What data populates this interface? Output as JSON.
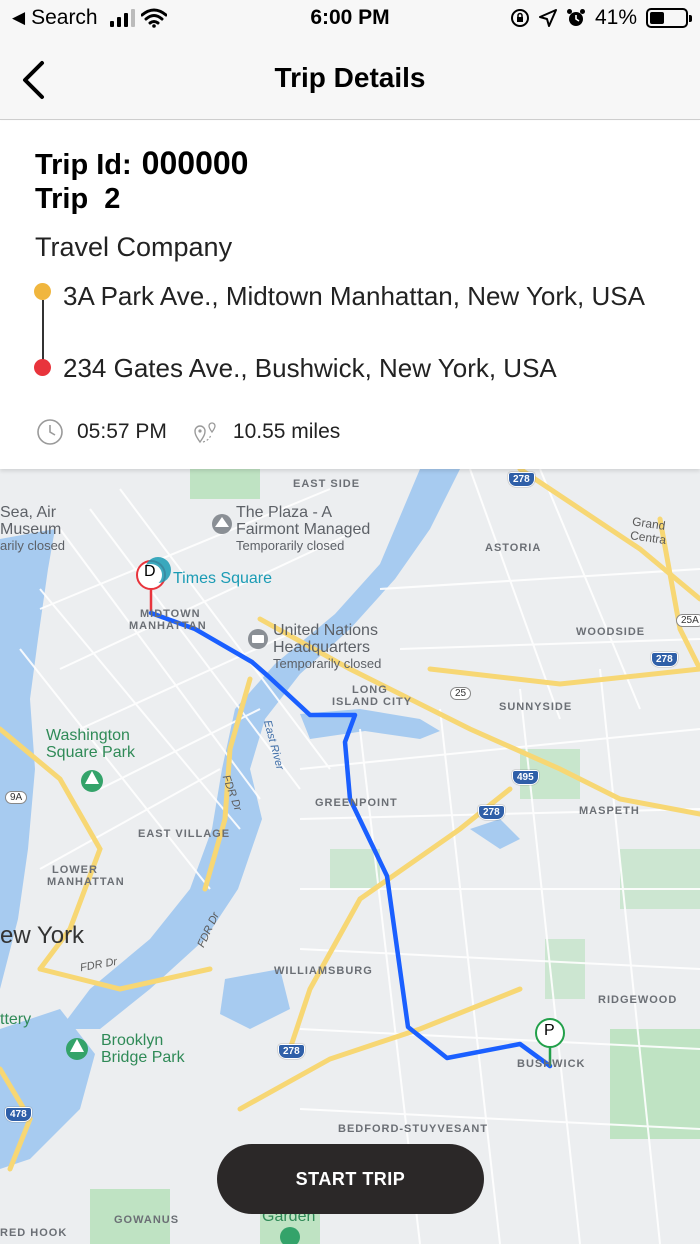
{
  "status_bar": {
    "back_label": "Search",
    "time": "6:00 PM",
    "battery": "41%",
    "battery_level": 0.41
  },
  "nav": {
    "title": "Trip Details"
  },
  "trip": {
    "id_label": "Trip Id:",
    "id_value": "000000",
    "name": "Trip  2",
    "company": "Travel Company",
    "origin": "3A Park Ave., Midtown Manhattan, New York, USA",
    "destination": "234 Gates Ave., Bushwick, New York, USA",
    "time": "05:57 PM",
    "distance": "10.55 miles"
  },
  "map": {
    "destination_marker": "D",
    "pickup_marker": "P",
    "route_color": "#1a5fff",
    "labels": {
      "east_side": "EAST SIDE",
      "astoria": "ASTORIA",
      "midtown": "MIDTOWN",
      "manhattan": "MANHATTAN",
      "woodside": "WOODSIDE",
      "long": "LONG",
      "island_city": "ISLAND CITY",
      "sunnyside": "SUNNYSIDE",
      "greenpoint": "GREENPOINT",
      "maspeth": "MASPETH",
      "east_village": "EAST VILLAGE",
      "lower": "LOWER",
      "lower_manhattan": "MANHATTAN",
      "williamsburg": "WILLIAMSBURG",
      "ridgewood": "RIDGEWOOD",
      "bushwick": "BUSHWICK",
      "bedford": "BEDFORD-STUYVESANT",
      "gowanus": "GOWANUS",
      "red_hook": "RED HOOK",
      "new_york": "ew York",
      "grand_central": "Grand Centra",
      "fdr_dr_1": "FDR Dr",
      "fdr_dr_2": "FDR Dr",
      "fdr_dr_3": "FDR Dr",
      "east_river": "East River"
    },
    "pois": {
      "sea_air": "Sea, Air",
      "museum": "Museum",
      "sea_closed": "arily closed",
      "plaza": "The Plaza - A",
      "plaza2": "Fairmont Managed",
      "plaza_closed": "Temporarily closed",
      "times_square": "Times Square",
      "un": "United Nations",
      "un2": "Headquarters",
      "un_closed": "Temporarily closed",
      "washington": "Washington",
      "washington2": "Square Park",
      "brooklyn": "Brooklyn",
      "brooklyn2": "Bridge Park",
      "garden": "Garden",
      "ttery": "ttery"
    },
    "shields": {
      "s278a": "278",
      "s278b": "278",
      "s278c": "278",
      "s278d": "278",
      "s25a": "25A",
      "s25": "25",
      "s495": "495",
      "s9a": "9A",
      "s478": "478"
    }
  },
  "actions": {
    "start_trip": "START TRIP"
  },
  "colors": {
    "origin_dot": "#f0b63e",
    "destination_dot": "#e8343c",
    "water": "#a7cbf0",
    "park": "#bfe3c3",
    "highway": "#f7d774",
    "button": "#2b2828"
  }
}
